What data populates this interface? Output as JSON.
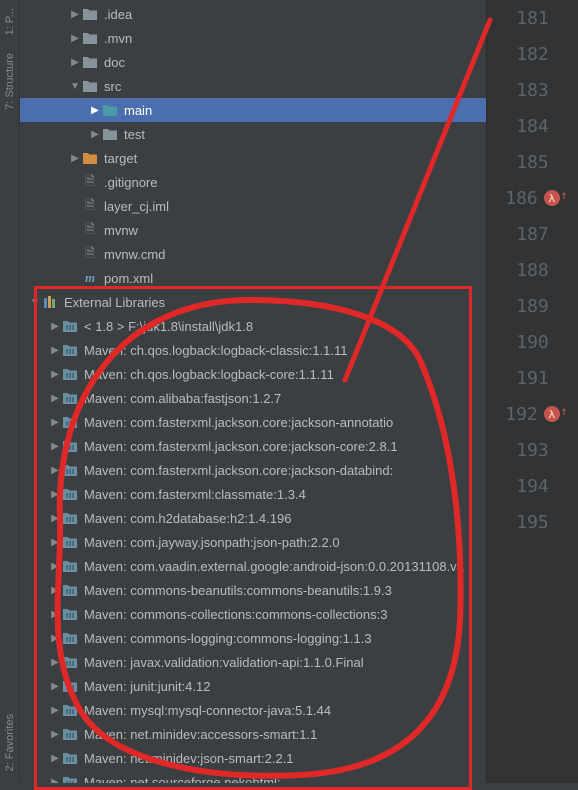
{
  "left_tabs": {
    "project": "1: P...",
    "structure": "7: Structure",
    "favorites": "2: Favorites"
  },
  "tree": [
    {
      "depth": 2,
      "arrow": "right",
      "icon": "folder-gray",
      "label": ".idea"
    },
    {
      "depth": 2,
      "arrow": "right",
      "icon": "folder-gray",
      "label": ".mvn"
    },
    {
      "depth": 2,
      "arrow": "right",
      "icon": "folder-gray",
      "label": "doc"
    },
    {
      "depth": 2,
      "arrow": "down",
      "icon": "folder-gray",
      "label": "src"
    },
    {
      "depth": 3,
      "arrow": "right",
      "icon": "folder-cyan",
      "label": "main",
      "selected": true
    },
    {
      "depth": 3,
      "arrow": "right",
      "icon": "folder-gray",
      "label": "test"
    },
    {
      "depth": 2,
      "arrow": "right",
      "icon": "folder-orange",
      "label": "target"
    },
    {
      "depth": 2,
      "arrow": "",
      "icon": "file",
      "label": ".gitignore"
    },
    {
      "depth": 2,
      "arrow": "",
      "icon": "file",
      "label": "layer_cj.iml"
    },
    {
      "depth": 2,
      "arrow": "",
      "icon": "file",
      "label": "mvnw"
    },
    {
      "depth": 2,
      "arrow": "",
      "icon": "file",
      "label": "mvnw.cmd"
    },
    {
      "depth": 2,
      "arrow": "",
      "icon": "m",
      "label": "pom.xml"
    },
    {
      "depth": 0,
      "arrow": "down",
      "icon": "extlib",
      "label": "External Libraries"
    },
    {
      "depth": 1,
      "arrow": "right",
      "icon": "lib",
      "label": "< 1.8 > F:\\jdk1.8\\install\\jdk1.8"
    },
    {
      "depth": 1,
      "arrow": "right",
      "icon": "lib",
      "label": "Maven: ch.qos.logback:logback-classic:1.1.11"
    },
    {
      "depth": 1,
      "arrow": "right",
      "icon": "lib",
      "label": "Maven: ch.qos.logback:logback-core:1.1.11"
    },
    {
      "depth": 1,
      "arrow": "right",
      "icon": "lib",
      "label": "Maven: com.alibaba:fastjson:1.2.7"
    },
    {
      "depth": 1,
      "arrow": "right",
      "icon": "lib",
      "label": "Maven: com.fasterxml.jackson.core:jackson-annotatio"
    },
    {
      "depth": 1,
      "arrow": "right",
      "icon": "lib",
      "label": "Maven: com.fasterxml.jackson.core:jackson-core:2.8.1"
    },
    {
      "depth": 1,
      "arrow": "right",
      "icon": "lib",
      "label": "Maven: com.fasterxml.jackson.core:jackson-databind:"
    },
    {
      "depth": 1,
      "arrow": "right",
      "icon": "lib",
      "label": "Maven: com.fasterxml:classmate:1.3.4"
    },
    {
      "depth": 1,
      "arrow": "right",
      "icon": "lib",
      "label": "Maven: com.h2database:h2:1.4.196"
    },
    {
      "depth": 1,
      "arrow": "right",
      "icon": "lib",
      "label": "Maven: com.jayway.jsonpath:json-path:2.2.0"
    },
    {
      "depth": 1,
      "arrow": "right",
      "icon": "lib",
      "label": "Maven: com.vaadin.external.google:android-json:0.0.20131108.va"
    },
    {
      "depth": 1,
      "arrow": "right",
      "icon": "lib",
      "label": "Maven: commons-beanutils:commons-beanutils:1.9.3"
    },
    {
      "depth": 1,
      "arrow": "right",
      "icon": "lib",
      "label": "Maven: commons-collections:commons-collections:3"
    },
    {
      "depth": 1,
      "arrow": "right",
      "icon": "lib",
      "label": "Maven: commons-logging:commons-logging:1.1.3"
    },
    {
      "depth": 1,
      "arrow": "right",
      "icon": "lib",
      "label": "Maven: javax.validation:validation-api:1.1.0.Final"
    },
    {
      "depth": 1,
      "arrow": "right",
      "icon": "lib",
      "label": "Maven: junit:junit:4.12"
    },
    {
      "depth": 1,
      "arrow": "right",
      "icon": "lib",
      "label": "Maven: mysql:mysql-connector-java:5.1.44"
    },
    {
      "depth": 1,
      "arrow": "right",
      "icon": "lib",
      "label": "Maven: net.minidev:accessors-smart:1.1"
    },
    {
      "depth": 1,
      "arrow": "right",
      "icon": "lib",
      "label": "Maven: net.minidev:json-smart:2.2.1"
    },
    {
      "depth": 1,
      "arrow": "right",
      "icon": "lib",
      "label": "Maven: net.sourceforge.nekohtml:..."
    }
  ],
  "gutter": {
    "lines": [
      181,
      182,
      183,
      184,
      185,
      186,
      187,
      188,
      189,
      190,
      191,
      192,
      193,
      194,
      195
    ],
    "lambda_lines": [
      186,
      192
    ]
  }
}
